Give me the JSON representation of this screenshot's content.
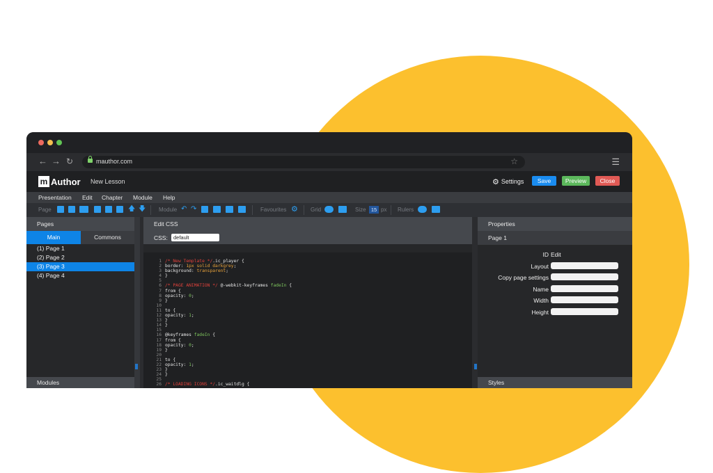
{
  "browser": {
    "url": "mauthor.com",
    "traffic_lights": [
      "#ed6a5e",
      "#f5bf4f",
      "#61c554"
    ]
  },
  "app": {
    "logo_mark": "m",
    "logo_text": "Author",
    "lesson_title": "New Lesson",
    "settings_label": "Settings",
    "save_label": "Save",
    "preview_label": "Preview",
    "close_label": "Close",
    "colors": {
      "save": "#1a8cf0",
      "preview": "#5cb85c",
      "close": "#e05a55",
      "accent": "#0e84e6"
    }
  },
  "menu": [
    "Presentation",
    "Edit",
    "Chapter",
    "Module",
    "Help"
  ],
  "toolbar": {
    "page_label": "Page",
    "module_label": "Module",
    "favourites_label": "Favourites",
    "grid_label": "Grid",
    "size_label": "Size",
    "size_value": "15",
    "size_unit": "px",
    "rulers_label": "Rulers"
  },
  "pages_panel": {
    "header": "Pages",
    "tabs": [
      "Main",
      "Commons"
    ],
    "pages": [
      "(1) Page 1",
      "(2) Page 2",
      "(3) Page 3",
      "(4) Page 4"
    ],
    "selected_index": 2,
    "footer": "Modules"
  },
  "editor": {
    "header": "Edit CSS",
    "css_label": "CSS:",
    "css_selected": "default",
    "lines": [
      [
        {
          "c": "c-cm",
          "t": "/* New Template */"
        },
        {
          "c": "c-k",
          "t": ".ic_player {"
        }
      ],
      [
        {
          "c": "c-k",
          "t": "border: "
        },
        {
          "c": "c-v",
          "t": "1px solid darkgrey"
        },
        {
          "c": "c-k",
          "t": ";"
        }
      ],
      [
        {
          "c": "c-k",
          "t": "background: "
        },
        {
          "c": "c-v",
          "t": "transparent"
        },
        {
          "c": "c-k",
          "t": ";"
        }
      ],
      [
        {
          "c": "c-k",
          "t": "}"
        }
      ],
      [],
      [
        {
          "c": "c-cm",
          "t": "/* PAGE ANIMATION */"
        },
        {
          "c": "c-k",
          "t": " @-webkit-keyframes "
        },
        {
          "c": "c-g",
          "t": "fadeIn"
        },
        {
          "c": "c-k",
          "t": " {"
        }
      ],
      [
        {
          "c": "c-k",
          "t": "from {"
        }
      ],
      [
        {
          "c": "c-k",
          "t": "opacity: "
        },
        {
          "c": "c-g",
          "t": "0"
        },
        {
          "c": "c-k",
          "t": ";"
        }
      ],
      [
        {
          "c": "c-k",
          "t": "}"
        }
      ],
      [],
      [
        {
          "c": "c-k",
          "t": "to {"
        }
      ],
      [
        {
          "c": "c-k",
          "t": "opacity: "
        },
        {
          "c": "c-g",
          "t": "1"
        },
        {
          "c": "c-k",
          "t": ";"
        }
      ],
      [
        {
          "c": "c-k",
          "t": "}"
        }
      ],
      [
        {
          "c": "c-k",
          "t": "}"
        }
      ],
      [],
      [
        {
          "c": "c-k",
          "t": "@keyframes "
        },
        {
          "c": "c-g",
          "t": "fadeIn"
        },
        {
          "c": "c-k",
          "t": " {"
        }
      ],
      [
        {
          "c": "c-k",
          "t": "from {"
        }
      ],
      [
        {
          "c": "c-k",
          "t": "opacity: "
        },
        {
          "c": "c-g",
          "t": "0"
        },
        {
          "c": "c-k",
          "t": ";"
        }
      ],
      [
        {
          "c": "c-k",
          "t": "}"
        }
      ],
      [],
      [
        {
          "c": "c-k",
          "t": "to {"
        }
      ],
      [
        {
          "c": "c-k",
          "t": "opacity: "
        },
        {
          "c": "c-g",
          "t": "1"
        },
        {
          "c": "c-k",
          "t": ";"
        }
      ],
      [
        {
          "c": "c-k",
          "t": "}"
        }
      ],
      [
        {
          "c": "c-k",
          "t": "}"
        }
      ],
      [],
      [
        {
          "c": "c-cm",
          "t": "/* LOADING ICONS */"
        },
        {
          "c": "c-k",
          "t": ".ic_waitdlg {"
        }
      ]
    ]
  },
  "properties": {
    "header": "Properties",
    "subheader": "Page 1",
    "id_label": "ID",
    "id_value": "Edit",
    "fields": [
      "Layout",
      "Copy page settings",
      "Name",
      "Width",
      "Height"
    ],
    "footer": "Styles"
  }
}
